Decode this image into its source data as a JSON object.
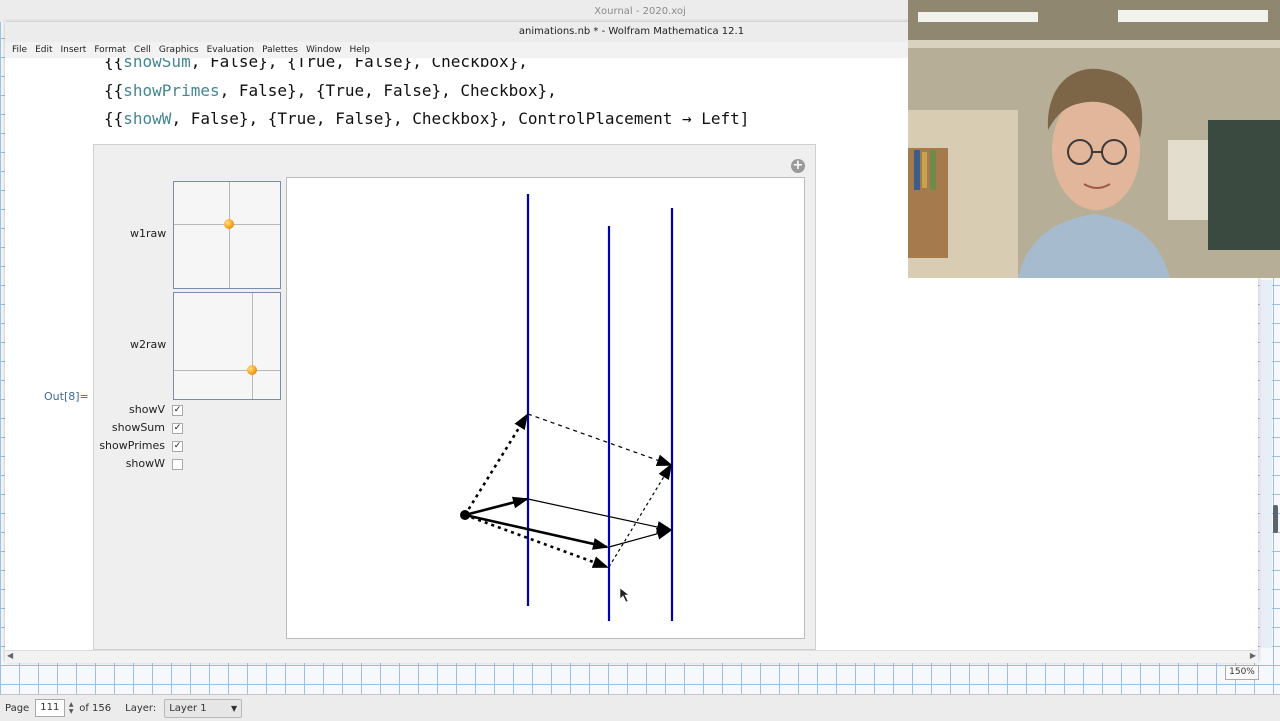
{
  "xournal": {
    "title": "Xournal - 2020.xoj",
    "status": {
      "page_label": "Page",
      "page_value": "111",
      "page_of": "of 156",
      "layer_label": "Layer:",
      "layer_value": "Layer 1",
      "zoom": "150%"
    }
  },
  "mathematica": {
    "title": "animations.nb * - Wolfram Mathematica 12.1",
    "menu": [
      "File",
      "Edit",
      "Insert",
      "Format",
      "Cell",
      "Graphics",
      "Evaluation",
      "Palettes",
      "Window",
      "Help"
    ],
    "code_lines": [
      {
        "prefix": "{{",
        "kw": "showSum",
        "rest": ", False}, {True, False}, Checkbox},"
      },
      {
        "prefix": "{{",
        "kw": "showPrimes",
        "rest": ", False}, {True, False}, Checkbox},"
      },
      {
        "prefix": "{{",
        "kw": "showW",
        "rest": ", False}, {True, False}, Checkbox}, ControlPlacement → Left]"
      }
    ],
    "output_label": "Out[8]=",
    "manipulate": {
      "sliders": [
        {
          "label": "w1raw",
          "value": [
            0.52,
            0.4
          ]
        },
        {
          "label": "w2raw",
          "value": [
            0.74,
            0.73
          ]
        }
      ],
      "checkboxes": [
        {
          "label": "showV",
          "checked": true,
          "mark": "✓"
        },
        {
          "label": "showSum",
          "checked": true,
          "mark": "✓"
        },
        {
          "label": "showPrimes",
          "checked": true,
          "mark": "✓"
        },
        {
          "label": "showW",
          "checked": false,
          "mark": ""
        }
      ],
      "plus_icon": "+"
    }
  },
  "colors": {
    "accent_blue": "#0000b0",
    "keyword": "#438695",
    "grid": "#9cc0e4"
  }
}
